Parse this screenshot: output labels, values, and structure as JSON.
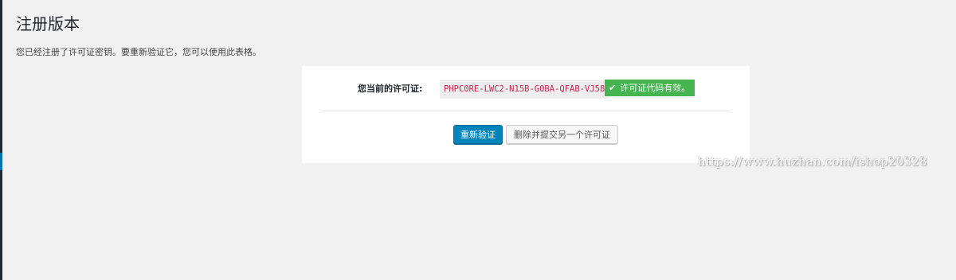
{
  "page": {
    "title": "注册版本",
    "intro": "您已经注册了许可证密钥。要重新验证它，您可以使用此表格。"
  },
  "license": {
    "label": "您当前的许可证:",
    "code": "PHPC0RE-LWC2-N15B-G0BA-QFAB-VJ58",
    "status_icon": "check-icon",
    "status_text": "许可证代码有效。"
  },
  "actions": {
    "revalidate_label": "重新验证",
    "remove_label": "删除并提交另一个许可证"
  },
  "watermark": {
    "text": "https://www.huzhan.com/ishop20328"
  },
  "colors": {
    "primary": "#0085ba",
    "success": "#46b450",
    "code_text": "#c7254e",
    "background": "#f1f1f1"
  }
}
